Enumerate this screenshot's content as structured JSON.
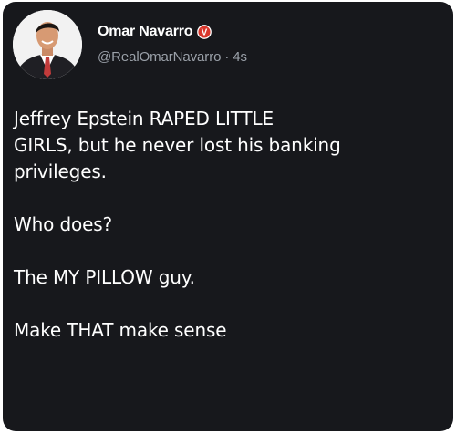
{
  "author": {
    "display_name": "Omar Navarro",
    "handle": "@RealOmarNavarro",
    "separator": "·",
    "time": "4s",
    "verified_badge": {
      "icon": "verified-v-badge-icon",
      "glyph": "V",
      "color": "#d9362b"
    }
  },
  "tweet": {
    "paragraphs": [
      "Jeffrey Epstein RAPED LITTLE\nGIRLS, but he never lost his banking\nprivileges.",
      "Who does?",
      "The MY PILLOW guy.",
      "Make THAT make sense"
    ]
  },
  "colors": {
    "background": "#17181c",
    "text_primary": "#ffffff",
    "text_secondary": "#9aa0a8"
  }
}
